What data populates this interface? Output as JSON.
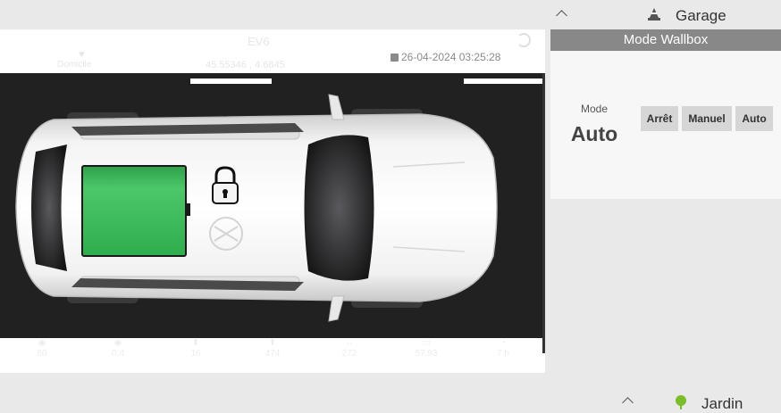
{
  "garage": {
    "title": "Garage"
  },
  "wallbox": {
    "panel_title": "Mode Wallbox",
    "mode_label": "Mode",
    "mode_value": "Auto",
    "buttons": [
      "Arrêt",
      "Manuel",
      "Auto"
    ]
  },
  "car": {
    "name": "EV6",
    "timestamp": "26-04-2024 03:25:28",
    "faint_location": "Domicile",
    "faint_coords": "45.55346 , 4.6845",
    "stats": [
      "60",
      "0.4",
      "16",
      "474",
      "272",
      "57.93",
      "7 h"
    ]
  },
  "jardin": {
    "title": "Jardin"
  },
  "colors": {
    "battery": "#34b152",
    "panel_header": "#888888",
    "stage_bg": "#212121"
  }
}
